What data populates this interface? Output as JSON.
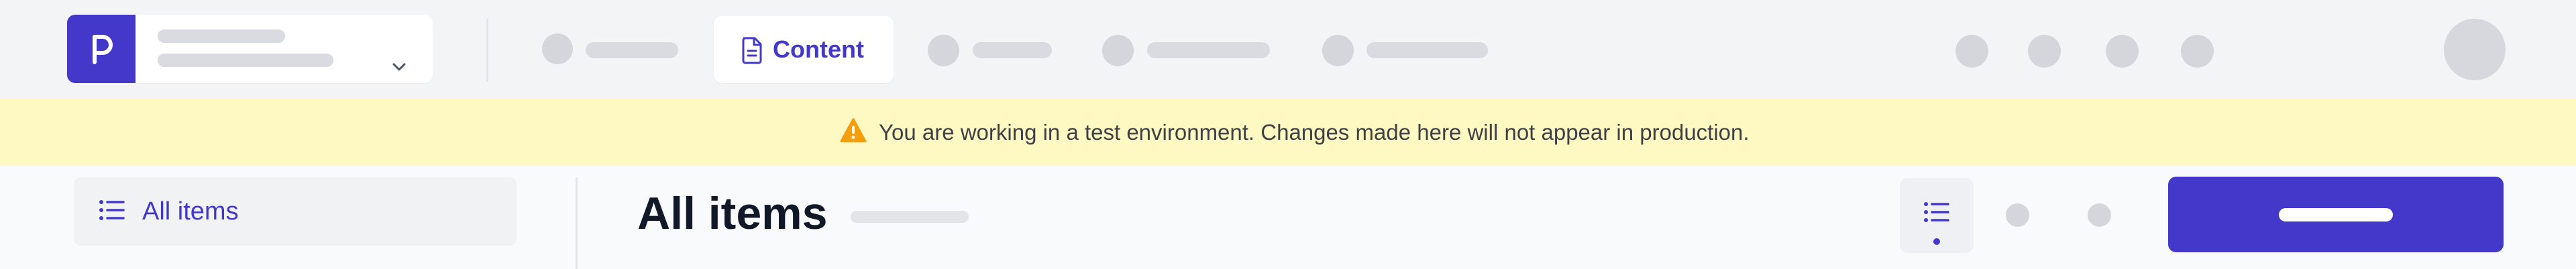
{
  "header": {
    "workspace_switcher": {
      "logo_icon": "p-logo-icon",
      "chevron_icon": "chevron-down-icon"
    },
    "nav": {
      "active_tab": {
        "label": "Content",
        "icon": "document-icon"
      }
    }
  },
  "banner": {
    "icon": "warning-triangle-icon",
    "message": "You are working in a test environment. Changes made here will not appear in production."
  },
  "sidebar": {
    "items": [
      {
        "label": "All items",
        "icon": "list-icon"
      }
    ]
  },
  "main": {
    "title": "All items",
    "view_toggle": {
      "icon": "list-view-icon"
    }
  },
  "colors": {
    "accent": "#4338ca",
    "banner_bg": "#fef9c3",
    "warning": "#f59e0b",
    "placeholder": "#d9dbe0"
  }
}
